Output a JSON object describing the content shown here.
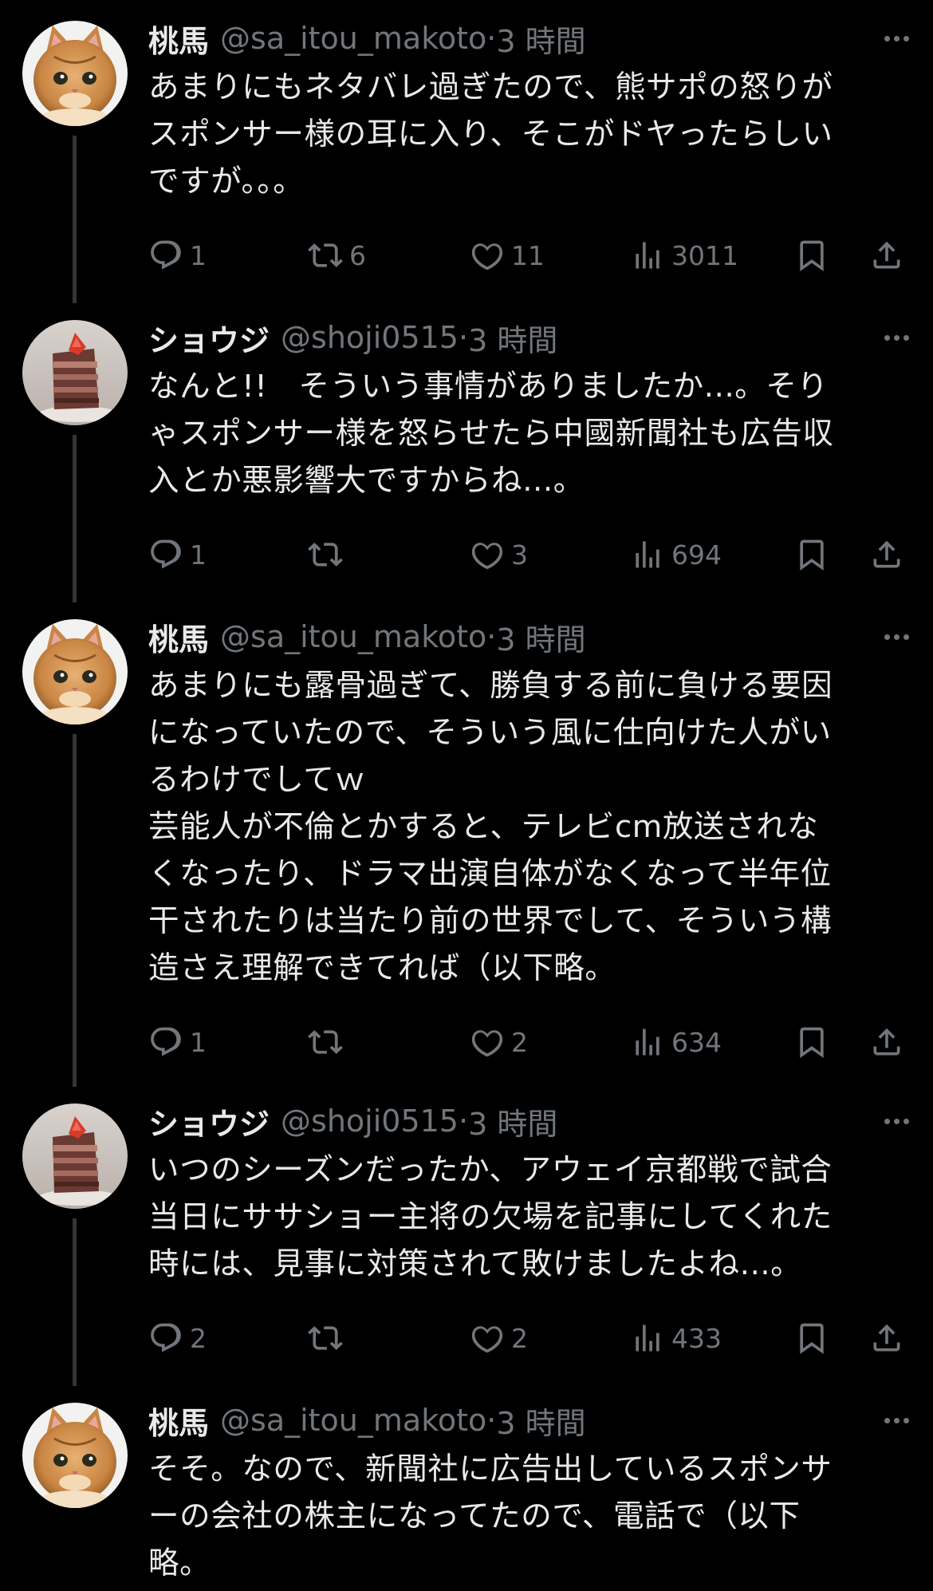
{
  "tweets": [
    {
      "name": "桃馬",
      "handle": "@sa_itou_makoto",
      "sep": "·",
      "time": "3 時間",
      "avatar": "cat-avatar",
      "lines": [
        "あまりにもネタバレ過ぎたので、熊サポの怒りが",
        "スポンサー様の耳に入り、そこがドヤったらしい",
        "ですが。。。"
      ],
      "replies": "1",
      "retweets": "6",
      "likes": "11",
      "views": "3011"
    },
    {
      "name": "ショウジ",
      "handle": "@shoji0515",
      "sep": "·",
      "time": "3 時間",
      "avatar": "cake-avatar",
      "lines": [
        "なんと!!　そういう事情がありましたか...。そり",
        "ゃスポンサー様を怒らせたら中國新聞社も広告収",
        "入とか悪影響大ですからね...。"
      ],
      "replies": "1",
      "retweets": "",
      "likes": "3",
      "views": "694"
    },
    {
      "name": "桃馬",
      "handle": "@sa_itou_makoto",
      "sep": "·",
      "time": "3 時間",
      "avatar": "cat-avatar",
      "lines": [
        "あまりにも露骨過ぎて、勝負する前に負ける要因",
        "になっていたので、そういう風に仕向けた人がい",
        "るわけでしてｗ",
        "芸能人が不倫とかすると、テレビcm放送されな",
        "くなったり、ドラマ出演自体がなくなって半年位",
        "干されたりは当たり前の世界でして、そういう構",
        "造さえ理解できてれば（以下略。"
      ],
      "replies": "1",
      "retweets": "",
      "likes": "2",
      "views": "634"
    },
    {
      "name": "ショウジ",
      "handle": "@shoji0515",
      "sep": "·",
      "time": "3 時間",
      "avatar": "cake-avatar",
      "lines": [
        "いつのシーズンだったか、アウェイ京都戦で試合",
        "当日にササショー主将の欠場を記事にしてくれた",
        "時には、見事に対策されて敗けましたよね...。"
      ],
      "replies": "2",
      "retweets": "",
      "likes": "2",
      "views": "433"
    },
    {
      "name": "桃馬",
      "handle": "@sa_itou_makoto",
      "sep": "·",
      "time": "3 時間",
      "avatar": "cat-avatar",
      "lines": [
        "そそ。なので、新聞社に広告出しているスポンサ",
        "ーの会社の株主になってたので、電話で（以下",
        "略。"
      ]
    }
  ],
  "colors": {
    "background": "#000000",
    "text": "#e7e9ea",
    "muted": "#71767b",
    "thread": "#333639"
  }
}
